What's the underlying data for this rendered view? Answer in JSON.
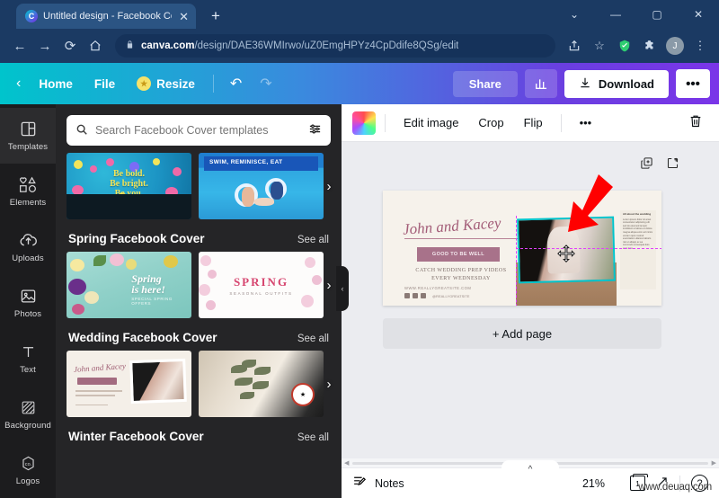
{
  "browser": {
    "tab": {
      "title": "Untitled design - Facebook Cover",
      "favicon": "canva-logo-icon",
      "close": "✕"
    },
    "new_tab_label": "+",
    "window_controls": {
      "chevron": "⌄",
      "minimize": "—",
      "maximize": "▢",
      "close": "✕"
    },
    "nav": {
      "back": "←",
      "forward": "→",
      "reload": "⟳",
      "home": "⌂"
    },
    "omnibox": {
      "lock": "🔒",
      "domain": "canva.com",
      "path": "/design/DAE36WMIrwo/uZ0EmgHPYz4CpDdife8QSg/edit"
    },
    "toolbar_icons": {
      "share": "share-icon",
      "bookmark": "☆",
      "shield": "✔",
      "extensions": "puzzle-icon",
      "profile_initial": "J",
      "menu": "⋮"
    }
  },
  "canva_topbar": {
    "back": "‹",
    "home": "Home",
    "file": "File",
    "resize": "Resize",
    "resize_badge": "crown-icon",
    "undo": "↶",
    "redo": "↷",
    "share": "Share",
    "insights_icon": "bar-chart-icon",
    "download": "Download",
    "download_icon": "download-arrow-icon",
    "more": "•••"
  },
  "sidebar": {
    "items": [
      {
        "label": "Templates",
        "icon": "templates-icon",
        "active": true
      },
      {
        "label": "Elements",
        "icon": "elements-icon",
        "active": false
      },
      {
        "label": "Uploads",
        "icon": "upload-cloud-icon",
        "active": false
      },
      {
        "label": "Photos",
        "icon": "photo-icon",
        "active": false
      },
      {
        "label": "Text",
        "icon": "text-icon",
        "active": false
      },
      {
        "label": "Background",
        "icon": "background-icon",
        "active": false
      },
      {
        "label": "Logos",
        "icon": "logos-icon",
        "active": false
      }
    ]
  },
  "panel": {
    "search": {
      "placeholder": "Search Facebook Cover templates",
      "icon": "search-icon",
      "filter_icon": "tune-icon"
    },
    "collapse_handle": "‹",
    "next_arrow": "›",
    "see_all": "See all",
    "rows": [
      {
        "title": "",
        "templates": [
          {
            "name": "be-bold-template",
            "line1": "Be bold.",
            "line2": "Be bright.",
            "line3": "Be you."
          },
          {
            "name": "swim-reminisce-template",
            "band_text": "SWIM, REMINISCE, EAT"
          }
        ]
      },
      {
        "title": "Spring Facebook Cover",
        "templates": [
          {
            "name": "spring-is-here-template",
            "line1": "Spring",
            "line2": "is here!",
            "sub": "SPECIAL SPRING OFFERS"
          },
          {
            "name": "spring-seasonal-template",
            "line1": "SPRING",
            "sub": "SEASONAL OUTFITS"
          }
        ]
      },
      {
        "title": "Wedding Facebook Cover",
        "templates": [
          {
            "name": "john-and-kacey-template",
            "script": "John and Kacey"
          },
          {
            "name": "bouquet-wedding-template",
            "script": ""
          }
        ]
      },
      {
        "title": "Winter Facebook Cover",
        "templates": []
      }
    ]
  },
  "editor": {
    "toolbar": {
      "thumbnail": "image-thumbnail",
      "edit_image": "Edit image",
      "crop": "Crop",
      "flip": "Flip",
      "more": "•••",
      "delete_icon": "trash-icon"
    },
    "float_actions": {
      "duplicate": "duplicate-icon",
      "add_page": "add-page-icon"
    },
    "design": {
      "script_title": "John and Kacey",
      "badge_text": "GOOD TO BE WELL",
      "subtitle_line1": "CATCH WEDDING PREP VIDEOS",
      "subtitle_line2": "EVERY WEDNESDAY",
      "website": "WWW.REALLYGREATSITE.COM",
      "handle": "@REALLYGREATSITE",
      "news_heading": "All about the wedding",
      "news_body": "Lorem ipsum dolor sit amet consectetur adipiscing elit sed do eiusmod tempor incididunt ut labore et dolore magna aliqua enim ad minim veniam quis nostrud exercitation ullamco laboris nisi ut aliquip ex ea commodo consequat duis aute irure.",
      "selected_element": "selected-photo"
    },
    "add_page_label": "+ Add page",
    "bottom": {
      "notes_label": "Notes",
      "notes_icon": "notes-icon",
      "zoom": "21%",
      "page_number": "1",
      "fullscreen_icon": "expand-icon",
      "help_icon": "?",
      "expand_chevron": "^"
    }
  },
  "watermark": "www.deuaq.com",
  "colors": {
    "canva_gradient_start": "#00c4cc",
    "canva_gradient_end": "#7a35e8",
    "browser_chrome": "#1b3a63",
    "selection": "#00c4cc",
    "guide": "#e040fb",
    "arrow": "#ff0000",
    "panel_bg": "#252527",
    "rail_bg": "#1c1c1e"
  }
}
